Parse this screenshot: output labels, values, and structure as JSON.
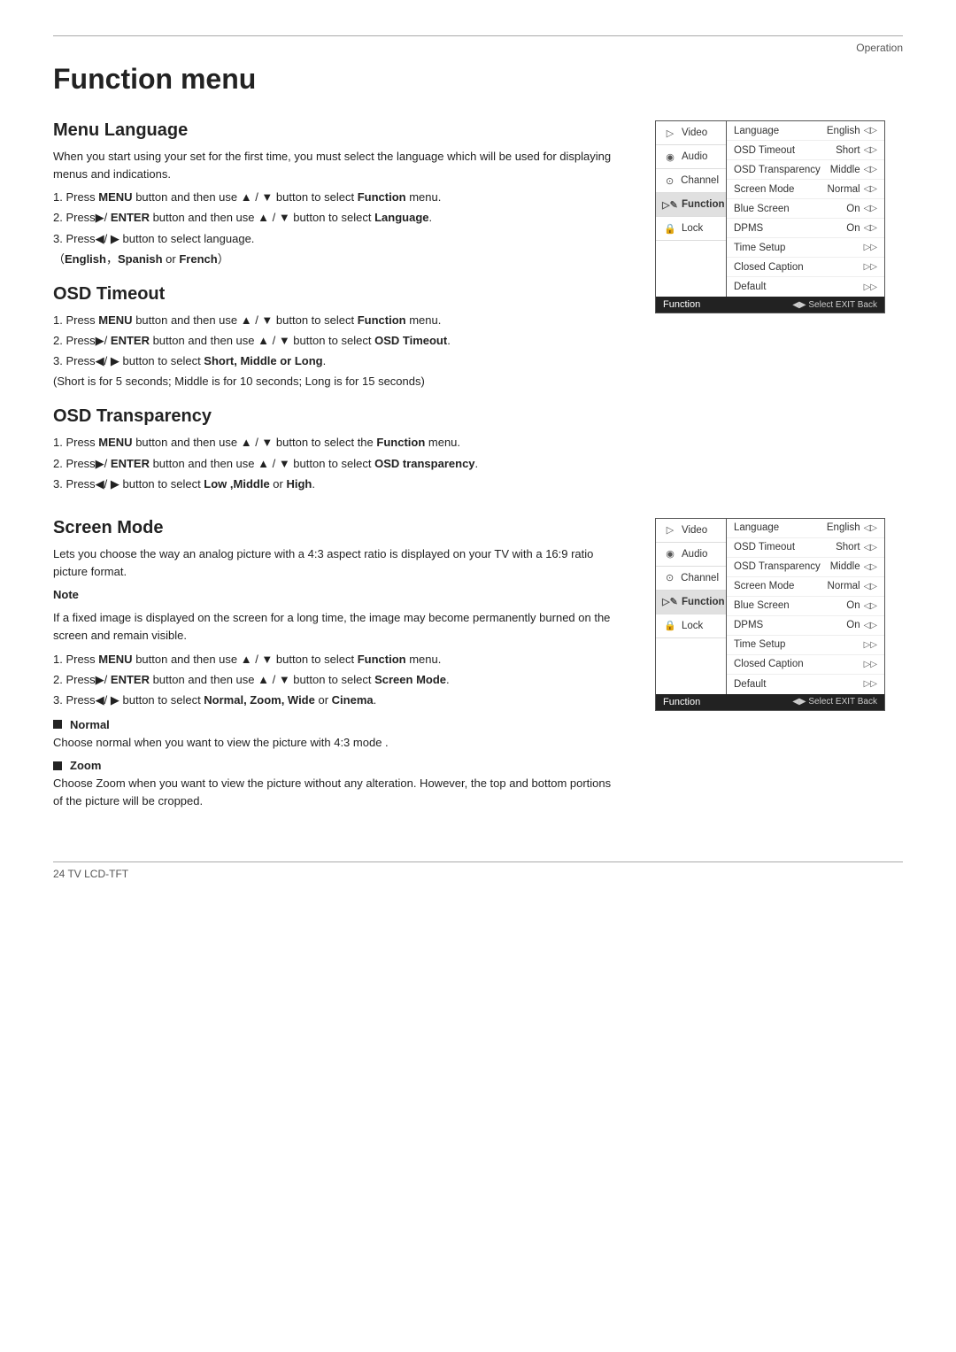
{
  "header": {
    "section": "Operation"
  },
  "page": {
    "title": "Function menu"
  },
  "sections": [
    {
      "id": "menu-language",
      "title": "Menu Language",
      "intro": "When you start using your set for the first time, you must select the language which will be used for displaying menus and indications.",
      "steps": [
        "1. Press <b>MENU</b> button and then use ▲ / ▼ button to select <b>Function</b> menu.",
        "2. Press▶/ <b>ENTER</b> button and then use ▲ / ▼ button to select <b>Language</b>.",
        "3. Press◀/ ▶ button to select  language.",
        "（<b>English</b>，<b>Spanish</b> or <b>French</b>）"
      ]
    },
    {
      "id": "osd-timeout",
      "title": "OSD Timeout",
      "steps": [
        "1. Press <b>MENU</b> button and then use ▲ / ▼ button to select <b>Function</b> menu.",
        "2. Press▶/ <b>ENTER</b> button and then use ▲ / ▼ button to select <b>OSD Timeout</b>.",
        "3. Press◀/ ▶ button to select <b>Short, Middle or Long</b>.",
        "(Short is for 5 seconds; Middle is for 10 seconds; Long is for 15 seconds)"
      ]
    },
    {
      "id": "osd-transparency",
      "title": "OSD Transparency",
      "steps": [
        "1. Press <b>MENU</b> button and then use ▲ / ▼ button to select the <b>Function</b> menu.",
        "2. Press▶/ <b>ENTER</b> button and then use ▲ / ▼ button to select <b>OSD transparency</b>.",
        "3. Press◀/ ▶ button to select <b>Low ,Middle</b> or <b>High</b>."
      ]
    },
    {
      "id": "screen-mode",
      "title": "Screen Mode",
      "intro": "Lets you choose the way an analog picture with a 4:3 aspect ratio is displayed on your TV with a 16:9 ratio picture format.",
      "note_label": "Note",
      "note": "If a fixed image is displayed on the screen for a long time, the image may become permanently burned on the screen and remain visible.",
      "steps": [
        "1. Press <b>MENU</b> button and then use ▲ / ▼ button to select <b>Function</b> menu.",
        "2. Press▶/ <b>ENTER</b> button and then use ▲ / ▼ button to select <b>Screen Mode</b>.",
        "3. Press◀/ ▶ button to select <b>Normal,  Zoom, Wide</b> or <b>Cinema</b>."
      ],
      "sub_sections": [
        {
          "title": "Normal",
          "body": "Choose normal when you want to view the picture with 4:3 mode ."
        },
        {
          "title": "Zoom",
          "body": "Choose Zoom when you want to view the picture without any alteration. However, the top and bottom portions of the picture will be cropped."
        }
      ]
    }
  ],
  "menu_box_1": {
    "sidebar": [
      {
        "label": "Video",
        "icon": "▷",
        "selected": false
      },
      {
        "label": "Audio",
        "icon": "◎",
        "selected": false
      },
      {
        "label": "Channel",
        "icon": "⊙",
        "selected": false
      },
      {
        "label": "Function",
        "icon": "✎",
        "selected": true
      },
      {
        "label": "Lock",
        "icon": "🔒",
        "selected": false
      }
    ],
    "rows": [
      {
        "label": "Language",
        "value": "English",
        "arrow": "◁▷"
      },
      {
        "label": "OSD Timeout",
        "value": "Short",
        "arrow": "◁▷"
      },
      {
        "label": "OSD Transparency",
        "value": "Middle",
        "arrow": "◁▷"
      },
      {
        "label": "Screen Mode",
        "value": "Normal",
        "arrow": "◁▷"
      },
      {
        "label": "Blue Screen",
        "value": "On",
        "arrow": "◁▷"
      },
      {
        "label": "DPMS",
        "value": "On",
        "arrow": "◁▷"
      },
      {
        "label": "Time Setup",
        "value": "",
        "arrow": "▷▷"
      },
      {
        "label": "Closed Caption",
        "value": "",
        "arrow": "▷▷"
      },
      {
        "label": "Default",
        "value": "",
        "arrow": "▷▷"
      }
    ],
    "footer_label": "Function",
    "footer_hints": "◀▶ Select  EXIT Back"
  },
  "menu_box_2": {
    "sidebar": [
      {
        "label": "Video",
        "icon": "▷",
        "selected": false
      },
      {
        "label": "Audio",
        "icon": "◎",
        "selected": false
      },
      {
        "label": "Channel",
        "icon": "⊙",
        "selected": false
      },
      {
        "label": "Function",
        "icon": "✎",
        "selected": true
      },
      {
        "label": "Lock",
        "icon": "🔒",
        "selected": false
      }
    ],
    "rows": [
      {
        "label": "Language",
        "value": "English",
        "arrow": "◁▷"
      },
      {
        "label": "OSD Timeout",
        "value": "Short",
        "arrow": "◁▷"
      },
      {
        "label": "OSD Transparency",
        "value": "Middle",
        "arrow": "◁▷"
      },
      {
        "label": "Screen Mode",
        "value": "Normal",
        "arrow": "◁▷"
      },
      {
        "label": "Blue Screen",
        "value": "On",
        "arrow": "◁▷"
      },
      {
        "label": "DPMS",
        "value": "On",
        "arrow": "◁▷"
      },
      {
        "label": "Time Setup",
        "value": "",
        "arrow": "▷▷"
      },
      {
        "label": "Closed Caption",
        "value": "",
        "arrow": "▷▷"
      },
      {
        "label": "Default",
        "value": "",
        "arrow": "▷▷"
      }
    ],
    "footer_label": "Function",
    "footer_hints": "◀▶ Select  EXIT Back"
  },
  "footer": {
    "label": "24  TV LCD-TFT"
  }
}
